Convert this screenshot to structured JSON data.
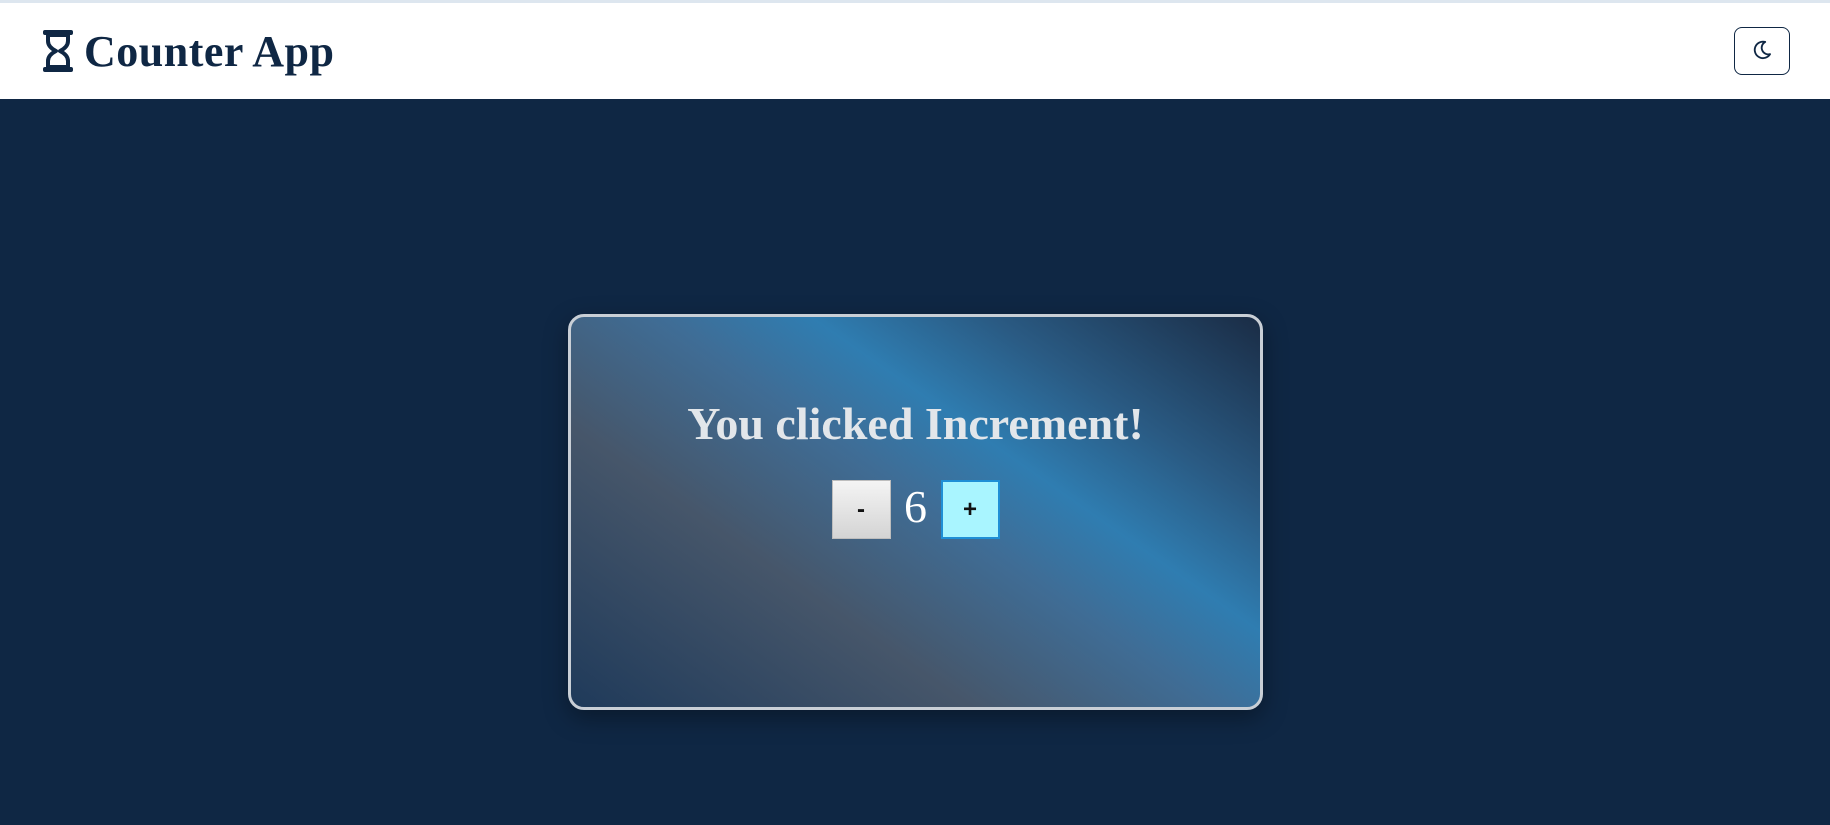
{
  "navbar": {
    "title": "Counter App",
    "brand_icon": "hourglass-icon",
    "theme_toggle_icon": "moon-icon"
  },
  "card": {
    "message": "You clicked Increment!",
    "decrement_label": "-",
    "count": "6",
    "increment_label": "+"
  },
  "colors": {
    "background": "#0f2744",
    "navbar": "#ffffff",
    "brand_text": "#0f2744",
    "increment_button": "#a9f5ff",
    "increment_border": "#1f8fd6"
  }
}
